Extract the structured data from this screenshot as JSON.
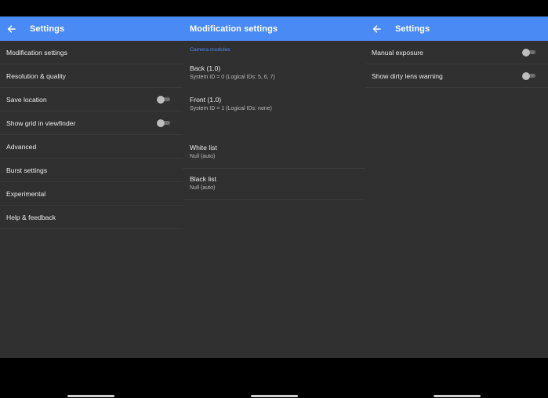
{
  "panel1": {
    "title": "Settings",
    "items": [
      {
        "label": "Modification settings"
      },
      {
        "label": "Resolution & quality"
      },
      {
        "label": "Save location",
        "toggle": false
      },
      {
        "label": "Show grid in viewfinder",
        "toggle": false
      },
      {
        "label": "Advanced"
      },
      {
        "label": "Burst settings"
      },
      {
        "label": "Experimental"
      },
      {
        "label": "Help & feedback"
      }
    ]
  },
  "panel2": {
    "title": "Modification settings",
    "section_header": "Camera modules",
    "back_module": {
      "title": "Back  (1.0)",
      "subtitle": "System ID = 0  (Logical IDs:  5, 6, 7)"
    },
    "front_module": {
      "title": "Front  (1.0)",
      "subtitle": "System ID = 1  (Logical IDs:  none)"
    },
    "white_list": {
      "title": "White list",
      "subtitle": "Null (auto)"
    },
    "black_list": {
      "title": "Black list",
      "subtitle": "Null (auto)"
    }
  },
  "panel3": {
    "title": "Settings",
    "items": [
      {
        "label": "Manual exposure",
        "toggle": false
      },
      {
        "label": "Show dirty lens warning",
        "toggle": false
      }
    ]
  },
  "colors": {
    "appbar": "#4a8af4",
    "background": "#303030",
    "accent": "#4a8af4"
  }
}
